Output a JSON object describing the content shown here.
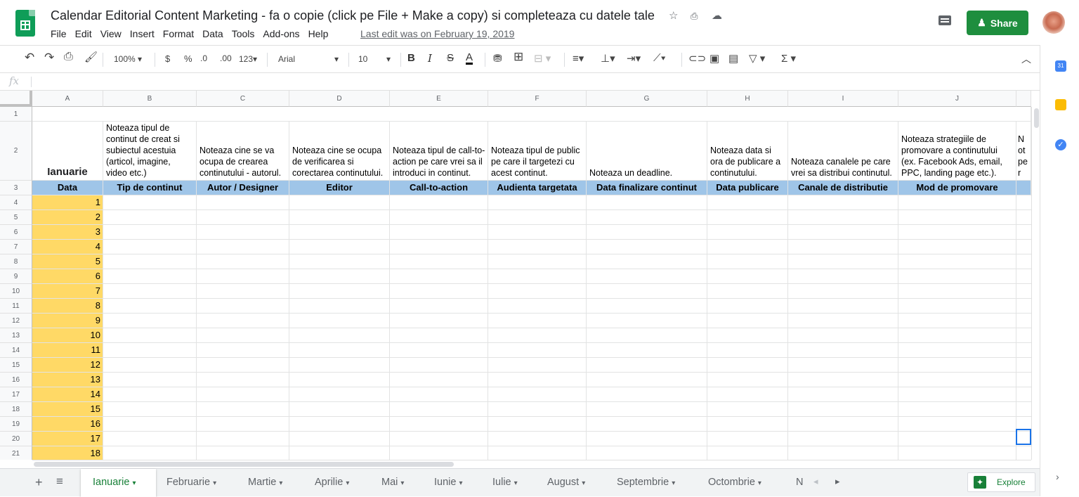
{
  "header": {
    "title": "Calendar Editorial Content Marketing - fa o copie (click pe File + Make a copy) si completeaza cu datele tale",
    "menus": [
      "File",
      "Edit",
      "View",
      "Insert",
      "Format",
      "Data",
      "Tools",
      "Add-ons",
      "Help"
    ],
    "last_edit": "Last edit was on February 19, 2019",
    "share_label": "Share"
  },
  "toolbar": {
    "zoom": "100%",
    "currency": "$",
    "percent": "%",
    "dec_decrease": ".0",
    "dec_increase": ".00",
    "more_formats": "123",
    "font": "Arial",
    "font_size": "10",
    "bold": "B",
    "italic": "I",
    "strike": "S",
    "text_color": "A",
    "sum": "Σ"
  },
  "formula_bar": {
    "fx": "fx",
    "value": ""
  },
  "columns": [
    "A",
    "B",
    "C",
    "D",
    "E",
    "F",
    "G",
    "H",
    "I",
    "J"
  ],
  "row_numbers": [
    "1",
    "2",
    "3",
    "4",
    "5",
    "6",
    "7",
    "8",
    "9",
    "10",
    "11",
    "12",
    "13",
    "14",
    "15",
    "16",
    "17",
    "18",
    "19",
    "20",
    "21"
  ],
  "sheet": {
    "month_label": "Ianuarie",
    "notes": [
      "Noteaza tipul de continut de creat si subiectul acestuia (articol, imagine, video etc.)",
      "Noteaza cine se va ocupa de crearea continutului - autorul.",
      "Noteaza cine se ocupa de verificarea si corectarea continutului.",
      "Noteaza tipul de call-to-action pe care vrei sa il introduci in continut.",
      "Noteaza tipul de public pe care il targetezi cu acest continut.",
      "Noteaza un deadline.",
      "Noteaza data si ora de publicare a continutului.",
      "Noteaza canalele pe care vrei sa distribui continutul.",
      "Noteaza strategiile de promovare a continutului (ex. Facebook Ads, email, PPC, landing page etc.).",
      "Not per"
    ],
    "headers": [
      "Data",
      "Tip de continut",
      "Autor / Designer",
      "Editor",
      "Call-to-action",
      "Audienta targetata",
      "Data finalizare continut",
      "Data publicare",
      "Canale de distributie",
      "Mod de promovare"
    ],
    "days": [
      "1",
      "2",
      "3",
      "4",
      "5",
      "6",
      "7",
      "8",
      "9",
      "10",
      "11",
      "12",
      "13",
      "14",
      "15",
      "16",
      "17",
      "18"
    ]
  },
  "tabs": [
    "Ianuarie",
    "Februarie",
    "Martie",
    "Aprilie",
    "Mai",
    "Iunie",
    "Iulie",
    "August",
    "Septembrie",
    "Octombrie",
    "N"
  ],
  "explore_label": "Explore",
  "colors": {
    "header_blue": "#9fc5e8",
    "date_yellow": "#ffd966",
    "share_green": "#1e8e3e",
    "tab_green": "#188038"
  }
}
